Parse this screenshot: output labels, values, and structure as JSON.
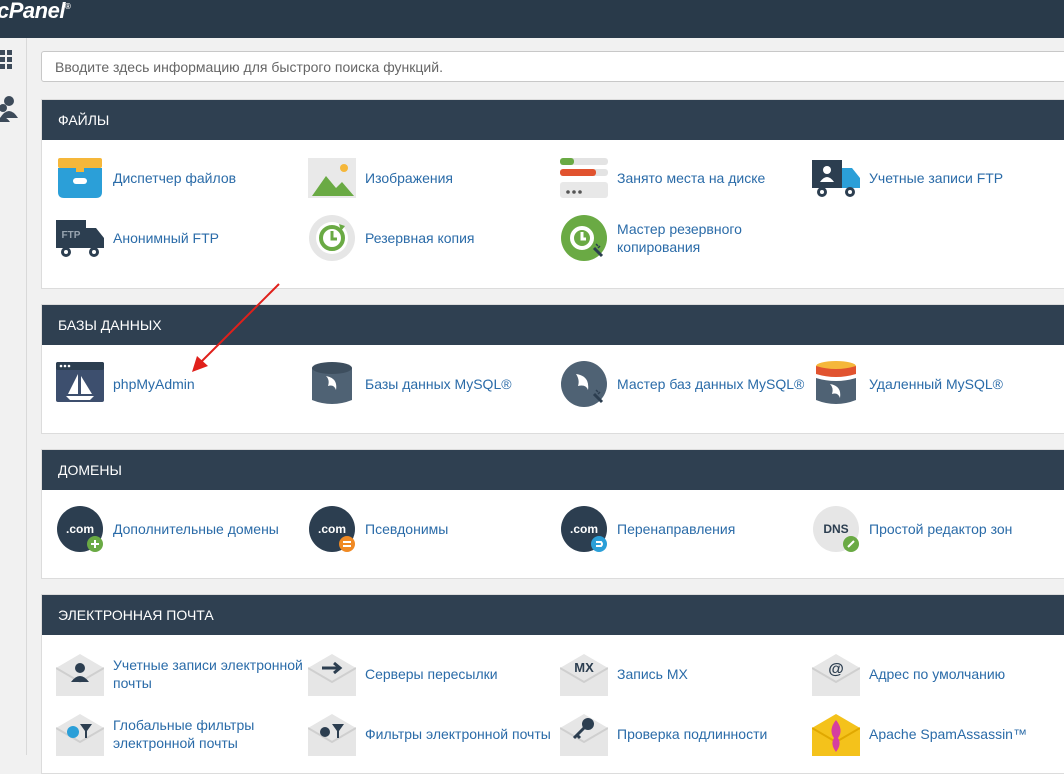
{
  "app": {
    "logo_text": "cPanel",
    "logo_mark": "®"
  },
  "search": {
    "placeholder": "Вводите здесь информацию для быстрого поиска функций."
  },
  "sections": [
    {
      "title": "ФАЙЛЫ",
      "items": [
        {
          "label": "Диспетчер файлов",
          "icon": "file-manager-icon"
        },
        {
          "label": "Изображения",
          "icon": "images-icon"
        },
        {
          "label": "Занято места на диске",
          "icon": "disk-usage-icon"
        },
        {
          "label": "Учетные записи FTP",
          "icon": "ftp-accounts-icon"
        },
        {
          "label": "Анонимный FTP",
          "icon": "anonymous-ftp-icon",
          "icon_text": "FTP"
        },
        {
          "label": "Резервная копия",
          "icon": "backup-icon"
        },
        {
          "label": "Мастер резервного копирования",
          "icon": "backup-wizard-icon"
        }
      ]
    },
    {
      "title": "БАЗЫ ДАННЫХ",
      "items": [
        {
          "label": "phpMyAdmin",
          "icon": "phpmyadmin-icon"
        },
        {
          "label": "Базы данных MySQL®",
          "icon": "mysql-databases-icon"
        },
        {
          "label": "Мастер баз данных MySQL®",
          "icon": "mysql-wizard-icon"
        },
        {
          "label": "Удаленный MySQL®",
          "icon": "remote-mysql-icon"
        }
      ]
    },
    {
      "title": "ДОМЕНЫ",
      "items": [
        {
          "label": "Дополнительные домены",
          "icon": "addon-domains-icon",
          "icon_text": ".com"
        },
        {
          "label": "Псевдонимы",
          "icon": "aliases-icon",
          "icon_text": ".com"
        },
        {
          "label": "Перенаправления",
          "icon": "redirects-icon",
          "icon_text": ".com"
        },
        {
          "label": "Простой редактор зон",
          "icon": "zone-editor-icon",
          "icon_text": "DNS"
        }
      ]
    },
    {
      "title": "ЭЛЕКТРОННАЯ ПОЧТА",
      "items": [
        {
          "label": "Учетные записи электронной почты",
          "icon": "email-accounts-icon"
        },
        {
          "label": "Серверы пересылки",
          "icon": "forwarders-icon"
        },
        {
          "label": "Запись MX",
          "icon": "mx-record-icon",
          "icon_text": "MX"
        },
        {
          "label": "Адрес по умолчанию",
          "icon": "default-address-icon",
          "icon_text": "@"
        },
        {
          "label": "Глобальные фильтры электронной почты",
          "icon": "global-filters-icon"
        },
        {
          "label": "Фильтры электронной почты",
          "icon": "email-filters-icon"
        },
        {
          "label": "Проверка подлинности",
          "icon": "authentication-icon"
        },
        {
          "label": "Apache SpamAssassin™",
          "icon": "spamassassin-icon"
        }
      ]
    }
  ],
  "colors": {
    "topbar": "#293a4a",
    "section_header": "#2f4051",
    "link": "#2a6ba8",
    "annotation_arrow": "#e0201b",
    "accent_green": "#6aaa44",
    "icon_dark": "#2c3e50"
  }
}
